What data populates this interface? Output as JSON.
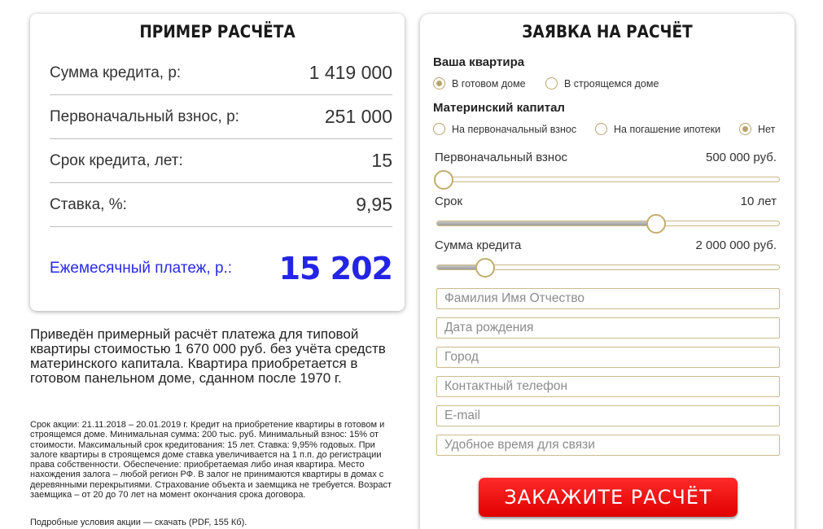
{
  "example": {
    "title": "ПРИМЕР РАСЧЁТА",
    "rows": [
      {
        "label": "Сумма кредита, р:",
        "value": "1 419 000"
      },
      {
        "label": "Первоначальный взнос, р:",
        "value": "251 000"
      },
      {
        "label": "Срок кредита, лет:",
        "value": "15"
      },
      {
        "label": "Ставка, %:",
        "value": "9,95"
      }
    ],
    "payment_label": "Ежемесячный платеж, р.:",
    "payment_value": "15 202",
    "description": "Приведён примерный расчёт платежа для типовой квартиры стоимостью 1 670 000 руб. без учёта средств материнского капитала. Квартира приобретается в готовом панельном доме, сданном после 1970 г.",
    "fine_print": "Срок акции: 21.11.2018 – 20.01.2019 г. Кредит на приобретение квартиры в готовом и строящемся доме. Минимальная сумма: 200 тыс. руб. Минимальный взнос: 15% от стоимости. Максимальный срок кредитования: 15 лет. Ставка: 9,95% годовых. При залоге квартиры в строящемся доме ставка увеличивается на 1 п.п. до регистрации права собственности. Обеспечение: приобретаемая либо иная квартира. Место нахождения залога – любой регион РФ. В залог не принимаются квартиры в домах с деревянными перекрытиями. Страхование объекта и заемщика не требуется. Возраст заемщика – от 20 до 70 лет на момент окончания срока договора.",
    "conditions_link": "Подробные условия акции — скачать (PDF, 155 Кб)."
  },
  "form": {
    "title": "ЗАЯВКА НА РАСЧЁТ",
    "apartment": {
      "title": "Ваша квартира",
      "options": [
        {
          "label": "В готовом доме",
          "selected": true
        },
        {
          "label": "В строящемся доме",
          "selected": false
        }
      ]
    },
    "capital": {
      "title": "Материнский капитал",
      "options": [
        {
          "label": "На первоначальный взнос",
          "selected": false
        },
        {
          "label": "На погашение ипотеки",
          "selected": false
        },
        {
          "label": "Нет",
          "selected": true
        }
      ]
    },
    "sliders": {
      "down_payment": {
        "label": "Первоначальный взнос",
        "value": "500 000 руб.",
        "level": 0.02
      },
      "term": {
        "label": "Срок",
        "value": "10 лет",
        "level": 0.64
      },
      "amount": {
        "label": "Сумма кредита",
        "value": "2 000 000 руб.",
        "level": 0.14
      }
    },
    "fields": {
      "name": "Фамилия Имя Отчество",
      "birth": "Дата рождения",
      "city": "Город",
      "phone": "Контактный телефон",
      "email": "E-mail",
      "time": "Удобное время для связи"
    },
    "submit_label": "ЗАКАЖИТЕ РАСЧЁТ"
  },
  "colors": {
    "payment": "#2424e6",
    "accent_gold": "#b8a36a",
    "submit": "#ff0000"
  }
}
